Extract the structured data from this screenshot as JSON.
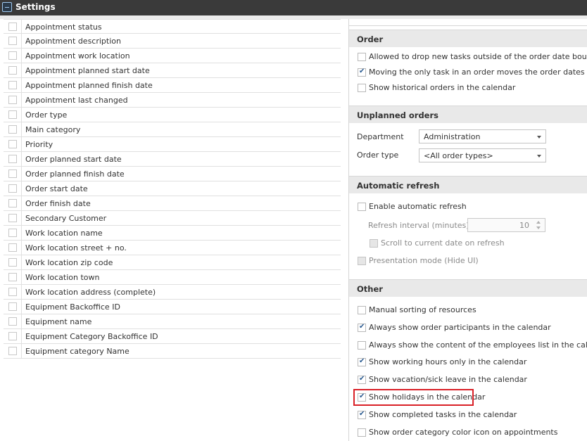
{
  "window": {
    "title": "Settings"
  },
  "left_list": {
    "items": [
      "Appointment status",
      "Appointment description",
      "Appointment work location",
      "Appointment planned start date",
      "Appointment planned finish date",
      "Appointment last changed",
      "Order type",
      "Main category",
      "Priority",
      "Order planned start date",
      "Order planned finish date",
      "Order start date",
      "Order finish date",
      "Secondary Customer",
      "Work location name",
      "Work location street + no.",
      "Work location zip code",
      "Work location town",
      "Work location address (complete)",
      "Equipment Backoffice ID",
      "Equipment name",
      "Equipment Category Backoffice ID",
      "Equipment category Name"
    ]
  },
  "order": {
    "header": "Order",
    "options": [
      {
        "label": "Allowed to drop new tasks outside of the order date boundaries",
        "checked": false
      },
      {
        "label": "Moving the only task in an order moves the order dates",
        "checked": true
      },
      {
        "label": "Show historical orders in the calendar",
        "checked": false
      }
    ]
  },
  "unplanned": {
    "header": "Unplanned orders",
    "department_label": "Department",
    "department_value": "Administration",
    "order_type_label": "Order type",
    "order_type_value": "<All order types>"
  },
  "refresh": {
    "header": "Automatic refresh",
    "enable_label": "Enable automatic refresh",
    "enable_checked": false,
    "interval_label": "Refresh interval (minutes):",
    "interval_value": "10",
    "scroll_label": "Scroll to current date on refresh",
    "presentation_label": "Presentation mode (Hide UI)"
  },
  "other": {
    "header": "Other",
    "options": [
      {
        "label": "Manual sorting of resources",
        "checked": false
      },
      {
        "label": "Always show order participants in the calendar",
        "checked": true
      },
      {
        "label": "Always show the content of the employees list in the calendar",
        "checked": false
      },
      {
        "label": "Show working hours only in the calendar",
        "checked": true
      },
      {
        "label": "Show vacation/sick leave in the calendar",
        "checked": true
      },
      {
        "label": "Show holidays in the calendar",
        "checked": true
      },
      {
        "label": "Show completed tasks in the calendar",
        "checked": true
      },
      {
        "label": "Show order category color icon on appointments",
        "checked": false
      }
    ]
  },
  "colors": {
    "titlebar": "#3a3a3a",
    "section_header": "#e9e9e9",
    "highlight": "#d92027",
    "check": "#2c5c92"
  }
}
